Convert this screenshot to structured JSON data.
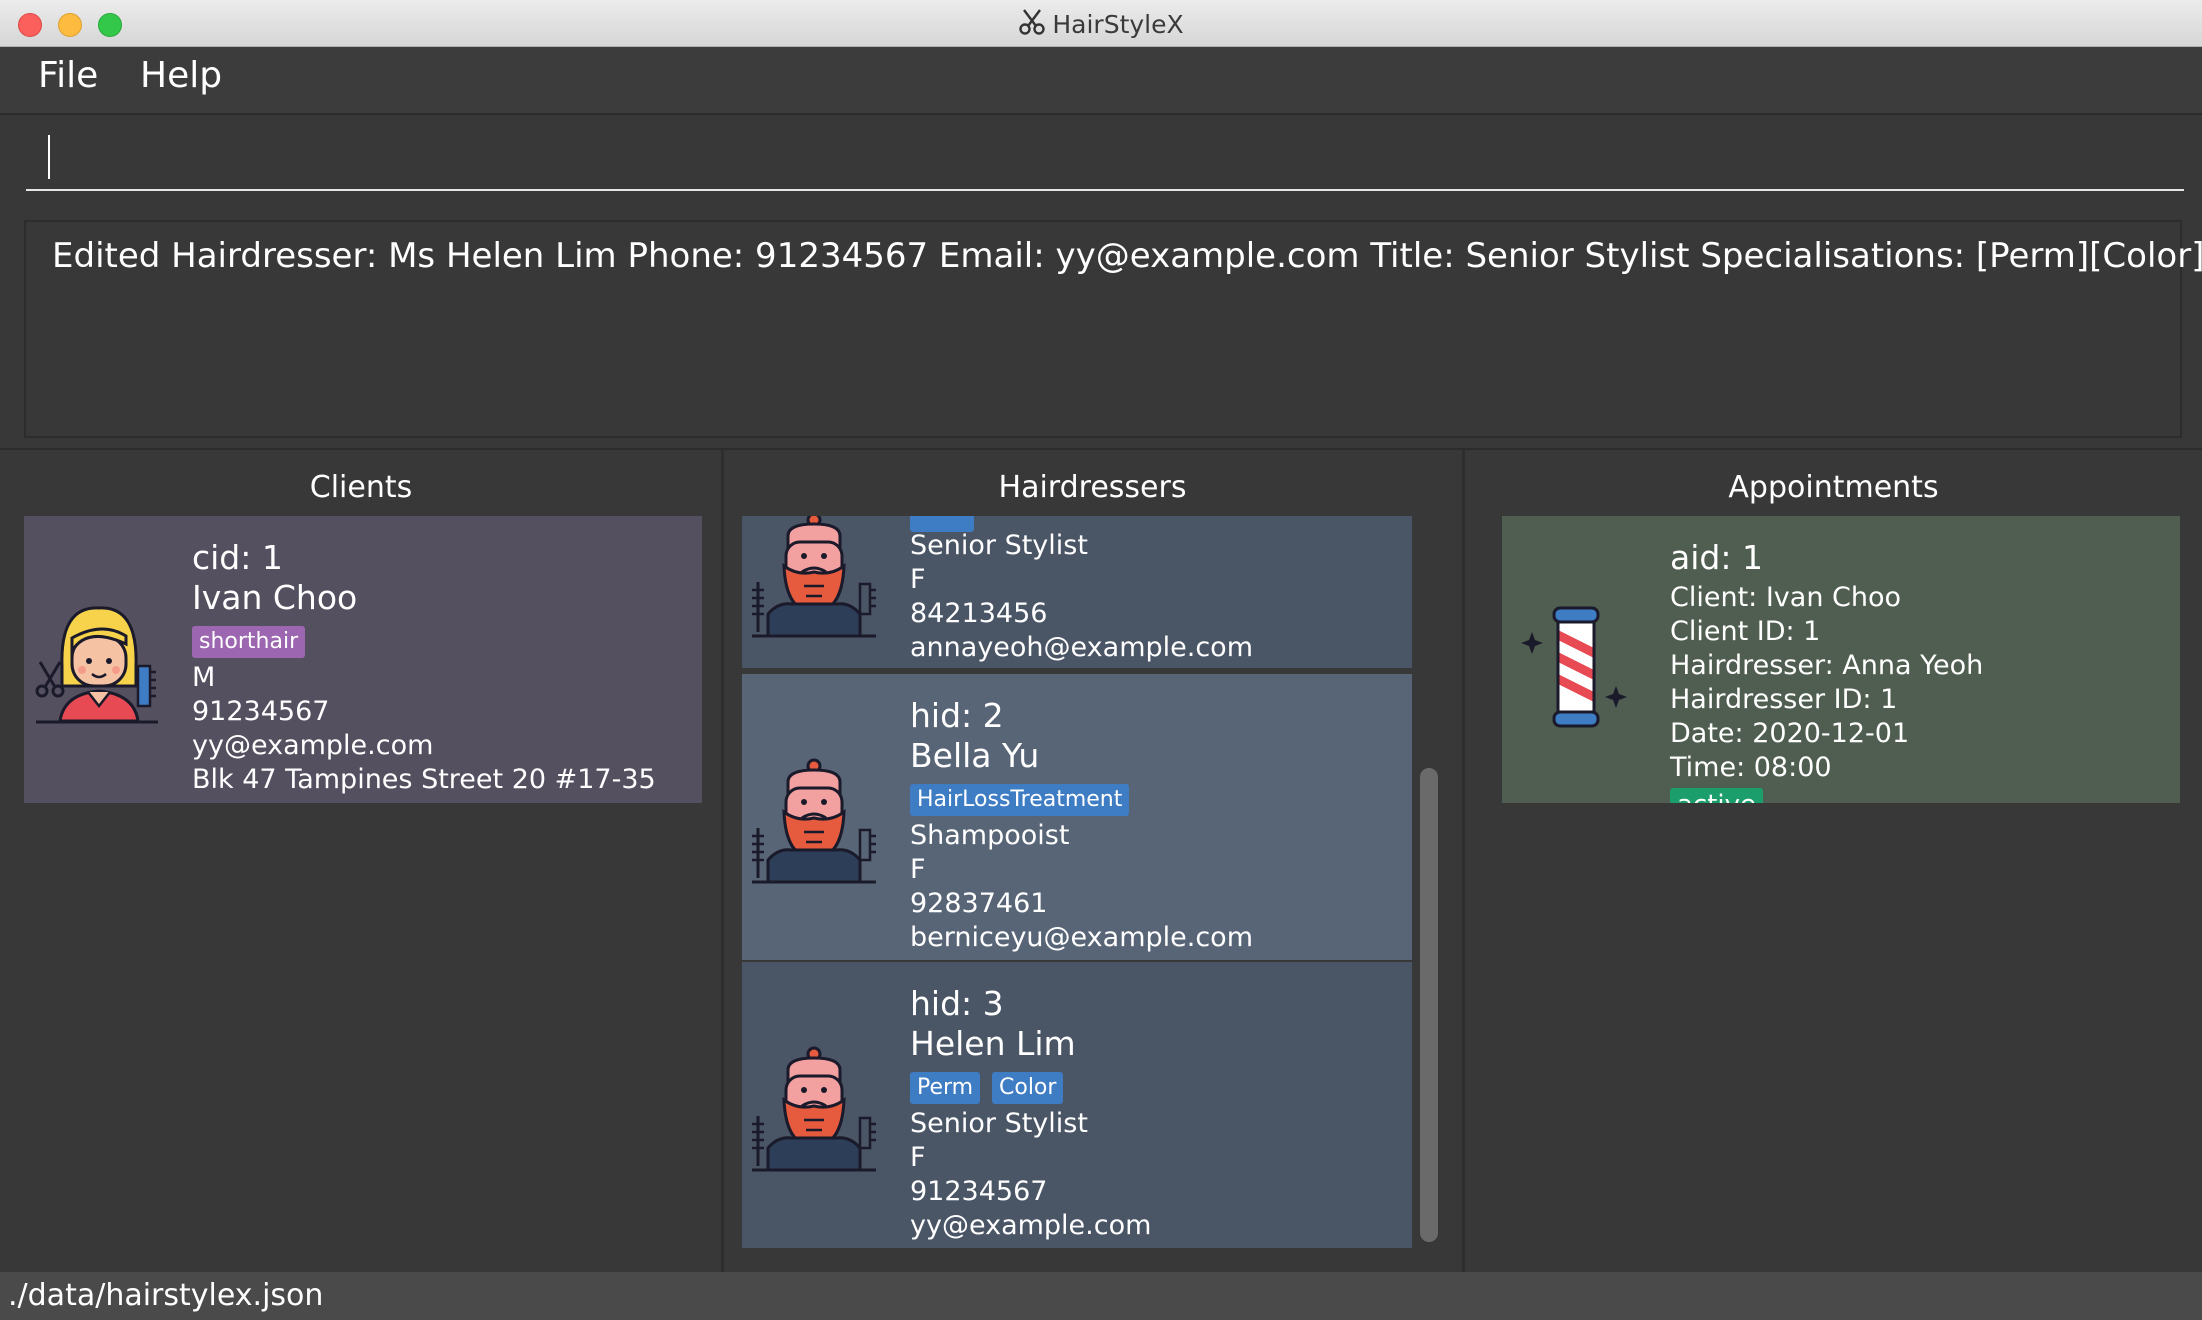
{
  "window": {
    "title": "HairStyleX"
  },
  "menu": {
    "file": "File",
    "help": "Help"
  },
  "command": {
    "value": ""
  },
  "result": {
    "text": "Edited Hairdresser: Ms Helen Lim Phone: 91234567 Email: yy@example.com Title: Senior Stylist Specialisations: [Perm][Color]"
  },
  "panels": {
    "clients": "Clients",
    "hairdressers": "Hairdressers",
    "appointments": "Appointments"
  },
  "clients": [
    {
      "id": "cid: 1",
      "name": "Ivan Choo",
      "tags": [
        "shorthair"
      ],
      "gender": "M",
      "phone": "91234567",
      "email": "yy@example.com",
      "address": "Blk 47 Tampines Street 20 #17-35"
    }
  ],
  "hairdressers": [
    {
      "title": "Senior Stylist",
      "gender": "F",
      "phone": "84213456",
      "email": "annayeoh@example.com"
    },
    {
      "id": "hid: 2",
      "name": "Bella Yu",
      "tags": [
        "HairLossTreatment"
      ],
      "title": "Shampooist",
      "gender": "F",
      "phone": "92837461",
      "email": "berniceyu@example.com"
    },
    {
      "id": "hid: 3",
      "name": "Helen Lim",
      "tags": [
        "Perm",
        "Color"
      ],
      "title": "Senior Stylist",
      "gender": "F",
      "phone": "91234567",
      "email": "yy@example.com"
    }
  ],
  "appointments": [
    {
      "id": "aid: 1",
      "client": "Client: Ivan Choo",
      "client_id": "Client ID: 1",
      "hairdresser": "Hairdresser: Anna Yeoh",
      "hairdresser_id": "Hairdresser ID: 1",
      "date": "Date: 2020-12-01",
      "time": "Time: 08:00",
      "status": "active"
    }
  ],
  "status": {
    "path": "./data/hairstylex.json"
  },
  "colors": {
    "client_card": "#545060",
    "hairdresser_card": "#4a5566",
    "appointment_card": "#4f5e50",
    "tag_purple": "#9c66b0",
    "tag_blue": "#3e7cc4",
    "tag_green": "#1b9e6b"
  },
  "icons": {
    "client_avatar": "hairdresser-woman-icon",
    "hairdresser_avatar": "bearded-barber-icon",
    "appointment_icon": "barber-pole-icon",
    "title_icon": "scissors-icon"
  }
}
